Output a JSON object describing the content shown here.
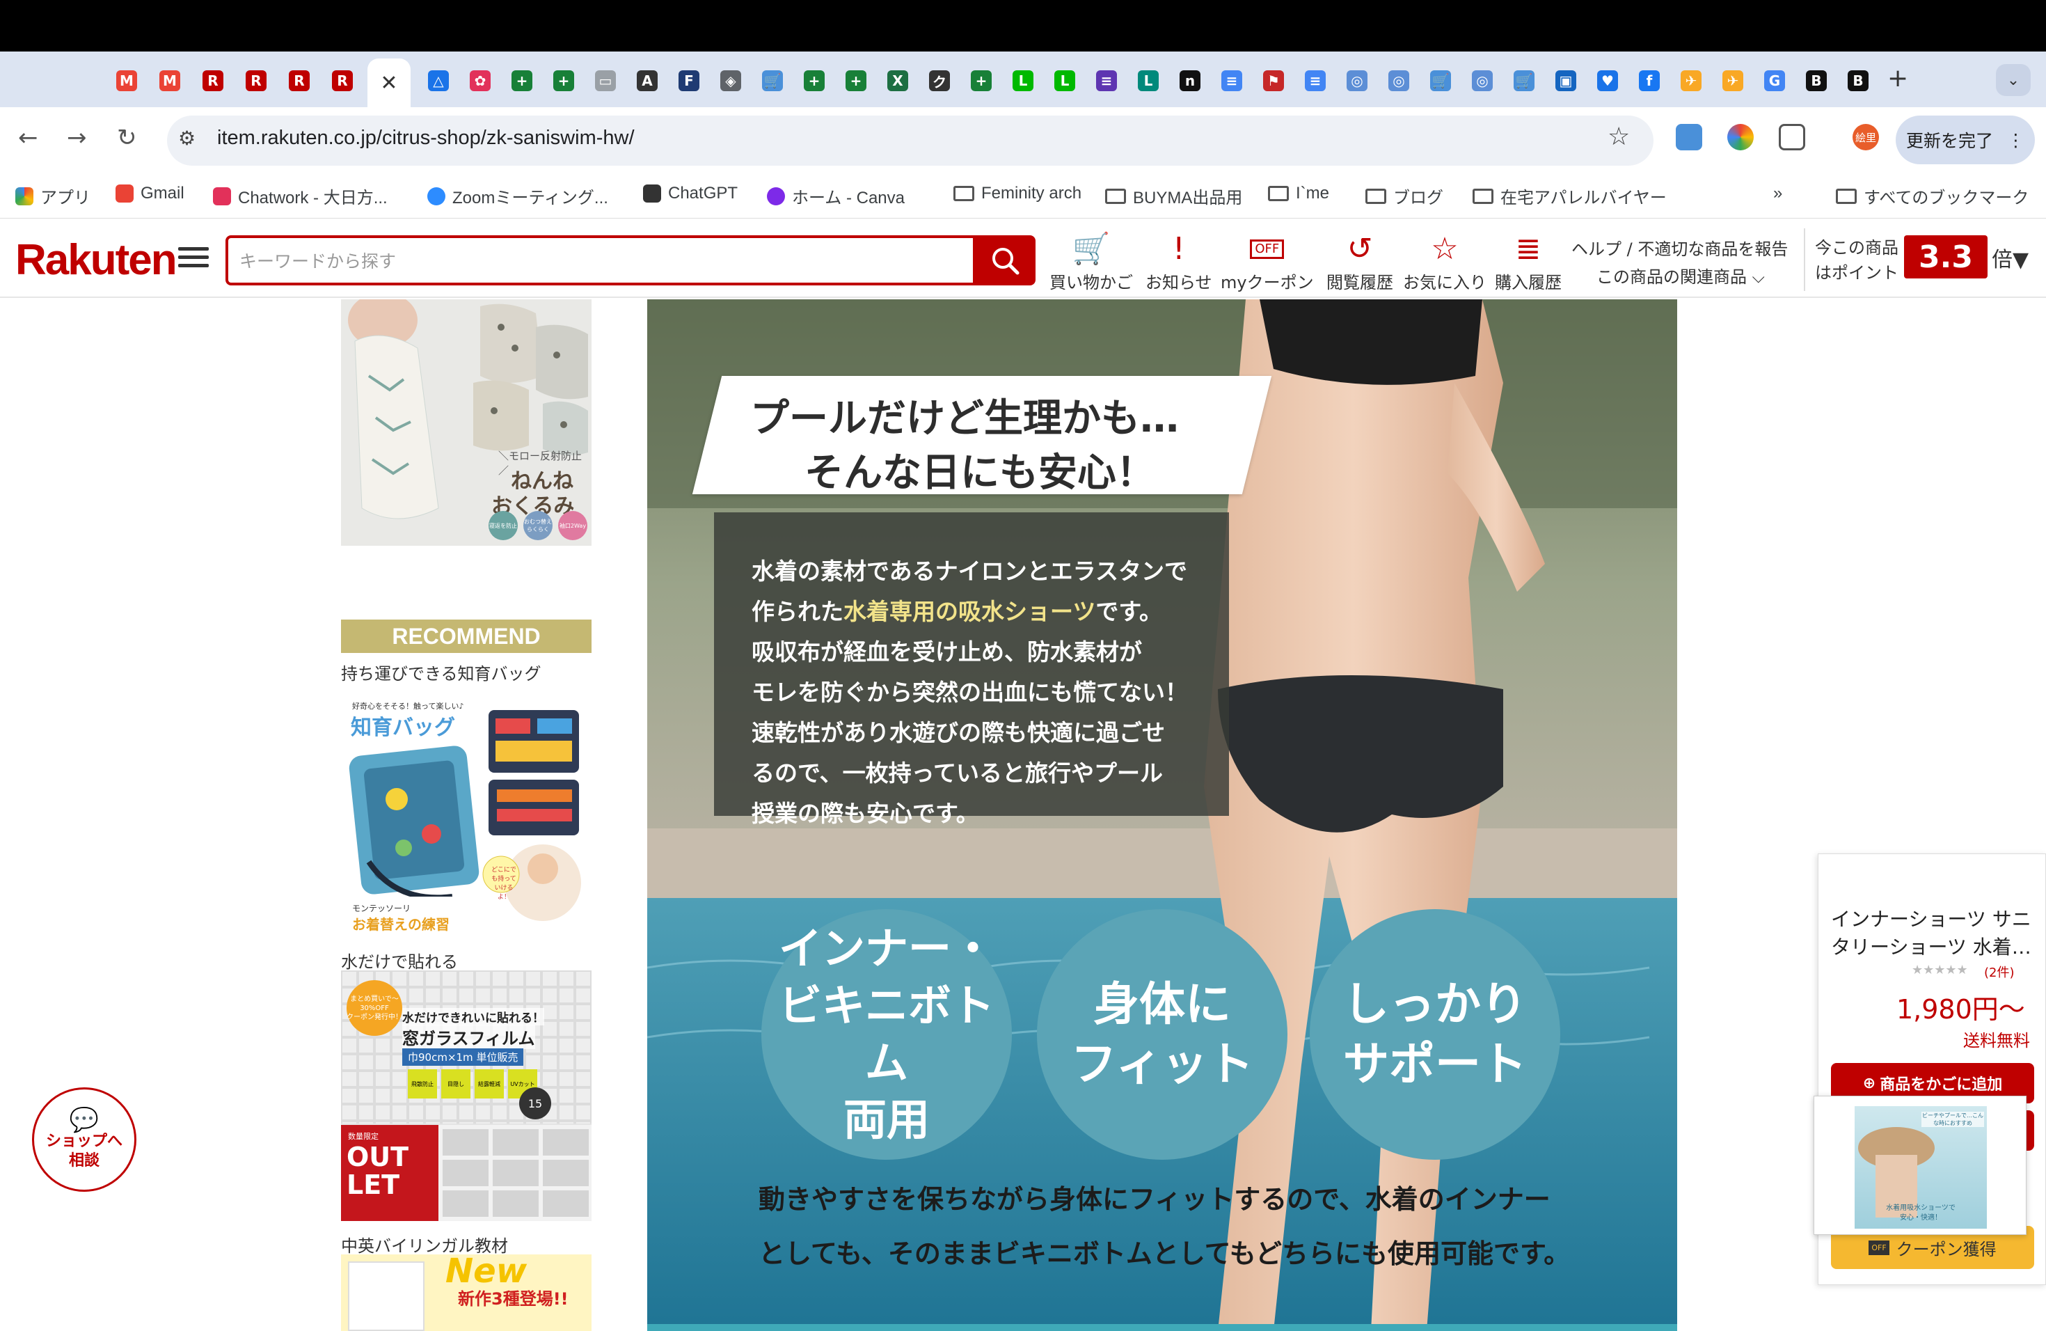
{
  "browser": {
    "url": "item.rakuten.co.jp/citrus-shop/zk-saniswim-hw/",
    "update_button": "更新を完了",
    "profile": "絵里",
    "tabs_favicons": [
      {
        "glyph": "M",
        "color": "#ea4335"
      },
      {
        "glyph": "M",
        "color": "#ea4335"
      },
      {
        "glyph": "R",
        "color": "#bf0000"
      },
      {
        "glyph": "R",
        "color": "#bf0000"
      },
      {
        "glyph": "R",
        "color": "#bf0000"
      },
      {
        "glyph": "R",
        "color": "#bf0000"
      }
    ],
    "tabs_after": [
      {
        "glyph": "△",
        "color": "#1a73e8"
      },
      {
        "glyph": "✿",
        "color": "#e2315a"
      },
      {
        "glyph": "+",
        "color": "#188038"
      },
      {
        "glyph": "+",
        "color": "#188038"
      },
      {
        "glyph": "▭",
        "color": "#9aa0a6"
      },
      {
        "glyph": "A",
        "color": "#333333"
      },
      {
        "glyph": "F",
        "color": "#1f3b73"
      },
      {
        "glyph": "◈",
        "color": "#5f6368"
      },
      {
        "glyph": "🛒",
        "color": "#4a90d9"
      },
      {
        "glyph": "+",
        "color": "#188038"
      },
      {
        "glyph": "+",
        "color": "#188038"
      },
      {
        "glyph": "X",
        "color": "#1d6f42"
      },
      {
        "glyph": "ク",
        "color": "#333333"
      },
      {
        "glyph": "+",
        "color": "#188038"
      },
      {
        "glyph": "L",
        "color": "#00b900"
      },
      {
        "glyph": "L",
        "color": "#00b900"
      },
      {
        "glyph": "≡",
        "color": "#5e35b1"
      },
      {
        "glyph": "L",
        "color": "#00897b"
      },
      {
        "glyph": "n",
        "color": "#111111"
      },
      {
        "glyph": "≡",
        "color": "#4285f4"
      },
      {
        "glyph": "⚑",
        "color": "#c62828"
      },
      {
        "glyph": "≡",
        "color": "#4285f4"
      },
      {
        "glyph": "◎",
        "color": "#5c8ed6"
      },
      {
        "glyph": "◎",
        "color": "#5c8ed6"
      },
      {
        "glyph": "🛒",
        "color": "#4a90d9"
      },
      {
        "glyph": "◎",
        "color": "#5c8ed6"
      },
      {
        "glyph": "🛒",
        "color": "#4a90d9"
      },
      {
        "glyph": "▣",
        "color": "#1565c0"
      },
      {
        "glyph": "♥",
        "color": "#1a73e8"
      },
      {
        "glyph": "f",
        "color": "#1877f2"
      },
      {
        "glyph": "✈",
        "color": "#f9a825"
      },
      {
        "glyph": "✈",
        "color": "#f9a825"
      },
      {
        "glyph": "G",
        "color": "#4285f4"
      },
      {
        "glyph": "B",
        "color": "#111111"
      },
      {
        "glyph": "B",
        "color": "#111111"
      }
    ],
    "bookmarks": [
      {
        "label": "アプリ",
        "icon": "apps-icon"
      },
      {
        "label": "Gmail",
        "icon": "gmail-icon"
      },
      {
        "label": "Chatwork - 大日方...",
        "icon": "chatwork-icon"
      },
      {
        "label": "Zoomミーティング...",
        "icon": "zoom-icon"
      },
      {
        "label": "ChatGPT",
        "icon": "chatgpt-icon"
      },
      {
        "label": "ホーム - Canva",
        "icon": "canva-icon"
      },
      {
        "label": "Feminity arch",
        "icon": "folder-icon"
      },
      {
        "label": "BUYMA出品用",
        "icon": "folder-icon"
      },
      {
        "label": "I`me",
        "icon": "folder-icon"
      },
      {
        "label": "ブログ",
        "icon": "folder-icon"
      },
      {
        "label": "在宅アパレルバイヤー",
        "icon": "folder-icon"
      }
    ],
    "bookmarks_overflow": "»",
    "all_bookmarks": "すべてのブックマーク"
  },
  "site": {
    "logo": "Rakuten",
    "search_placeholder": "キーワードから探す",
    "nav": [
      {
        "label": "買い物かご",
        "icon": "cart-icon",
        "glyph": "🛒"
      },
      {
        "label": "お知らせ",
        "icon": "notice-icon",
        "glyph": "!"
      },
      {
        "label": "myクーポン",
        "icon": "coupon-icon",
        "glyph": "OFF"
      },
      {
        "label": "閲覧履歴",
        "icon": "history-icon",
        "glyph": "↺"
      },
      {
        "label": "お気に入り",
        "icon": "favorite-icon",
        "glyph": "☆"
      },
      {
        "label": "購入履歴",
        "icon": "purchase-history-icon",
        "glyph": "≣"
      }
    ],
    "help_line1": "ヘルプ / 不適切な商品を報告",
    "help_line2": "この商品の関連商品",
    "points_label1": "今この商品",
    "points_label2": "はポイント",
    "points_value": "3.3",
    "points_unit": "倍"
  },
  "sidebar": {
    "top_banner": {
      "small": "＼モロー反射防止／",
      "title1": "ねんね",
      "title2": "おくるみ",
      "badges": [
        "寝返を防止",
        "おむつ替えらくらく",
        "袖口2Way"
      ]
    },
    "recommend": "RECOMMEND",
    "items": [
      {
        "caption": "持ち運びできる知育バッグ",
        "banner_top": "好奇心をそそる！触って楽しい♪",
        "banner_title": "知育バッグ",
        "banner_sub": "どこにでも持っていけるよ！",
        "banner_bottom": "モンテッソーリ",
        "banner_bottom2": "お着替えの練習"
      },
      {
        "caption": "水だけで貼れる",
        "badge": "まとめ買いで〜30%OFF",
        "badge_sub": "クーポン発行中！",
        "title": "水だけできれいに貼れる！",
        "title2": "窓ガラスフィルム",
        "size": "巾90cm×1m 単位販売",
        "icons": [
          "飛散防止",
          "目隠し",
          "結露軽減",
          "UVカット"
        ],
        "patterns": "15",
        "outlet_small": "数量限定",
        "outlet": "OUT LET"
      },
      {
        "caption": "中英バイリンガル教材",
        "new": "New",
        "banner": "新作3種登場!!"
      }
    ]
  },
  "main": {
    "headline1": "プールだけど生理かも…",
    "headline2": "そんな日にも安心！",
    "body": [
      "水着の素材であるナイロンとエラスタンで",
      "作られた",
      "水着専用の吸水ショーツ",
      "です。",
      "吸収布が経血を受け止め、防水素材が",
      "モレを防ぐから突然の出血にも慌てない！",
      "速乾性があり水遊びの際も快適に過ごせ",
      "るので、一枚持っていると旅行やプール",
      "授業の際も安心です。"
    ],
    "circles": [
      [
        "インナー・",
        "ビキニボトム",
        "両用"
      ],
      [
        "身体に",
        "フィット"
      ],
      [
        "しっかり",
        "サポート"
      ]
    ],
    "footer1": "動きやすさを保ちながら身体にフィットするので、水着のインナー",
    "footer2": "としても、そのままビキニボトムとしてもどちらにも使用可能です。"
  },
  "chat_button": {
    "line1": "ショップへ",
    "line2": "相談"
  },
  "side_panel": {
    "title1": "インナーショーツ サニ",
    "title2": "タリーショーツ 水着…",
    "stars": "★★★★★",
    "reviews": "(2件)",
    "price": "1,980円〜",
    "shipping": "送料無料",
    "cart_button": "商品をかごに追加",
    "coupon_button": "クーポン獲得",
    "popup_caption1": "水着用吸水ショーツで",
    "popup_caption2": "安心・快適！",
    "popup_top": "ビーチやプールで…こんな時におすすめ"
  }
}
